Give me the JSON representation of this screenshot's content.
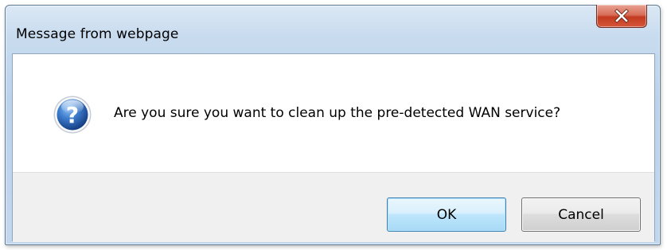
{
  "dialog": {
    "title": "Message from webpage",
    "message": "Are you sure you want to clean up the pre-detected WAN service?",
    "icon": "question-icon",
    "close_icon": "close-icon",
    "buttons": {
      "ok_label": "OK",
      "cancel_label": "Cancel"
    }
  },
  "colors": {
    "close_button": "#c23a20",
    "question_icon": "#1f5aa8",
    "ok_border": "#3c7fb1",
    "button_bar": "#f0f0f0"
  }
}
